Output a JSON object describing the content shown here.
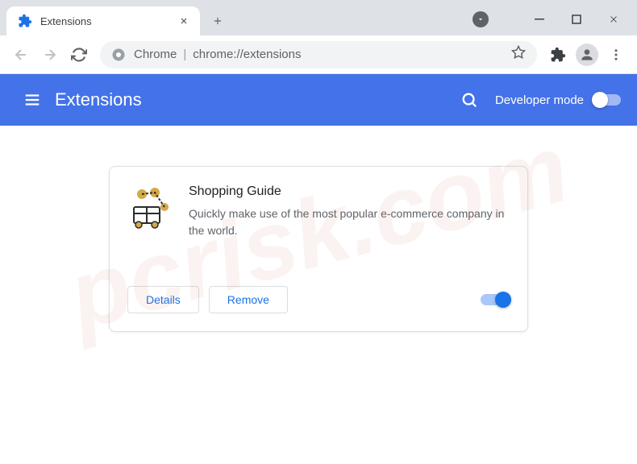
{
  "tab": {
    "title": "Extensions"
  },
  "omnibox": {
    "app": "Chrome",
    "url": "chrome://extensions"
  },
  "header": {
    "title": "Extensions",
    "dev_mode_label": "Developer mode"
  },
  "extension": {
    "name": "Shopping Guide",
    "description": "Quickly make use of the most popular e-commerce company in the world.",
    "details_label": "Details",
    "remove_label": "Remove"
  },
  "watermark": "pcrisk.com"
}
